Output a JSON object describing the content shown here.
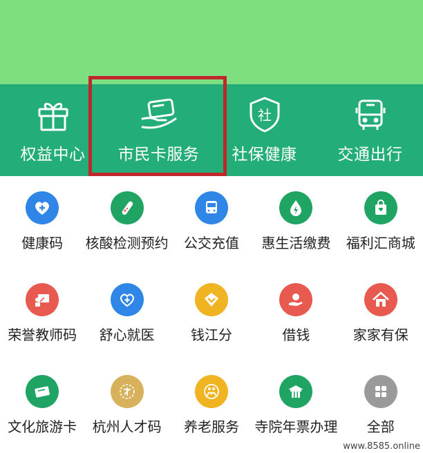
{
  "colors": {
    "banner": "#7ddf7f",
    "main_bar": "#23ad78",
    "highlight": "#c0272d"
  },
  "main_services": [
    {
      "label": "权益中心",
      "icon": "gift-icon"
    },
    {
      "label": "市民卡服务",
      "icon": "card-in-hand-icon"
    },
    {
      "label": "社保健康",
      "icon": "social-security-shield-icon"
    },
    {
      "label": "交通出行",
      "icon": "bus-icon"
    }
  ],
  "shield_text": "社",
  "services": [
    {
      "label": "健康码",
      "icon": "heart-plus-icon",
      "color": "#2f86e6"
    },
    {
      "label": "核酸检测预约",
      "icon": "test-tube-icon",
      "color": "#1fa463"
    },
    {
      "label": "公交充值",
      "icon": "bus-icon",
      "color": "#2f86e6"
    },
    {
      "label": "惠生活缴费",
      "icon": "drop-bolt-icon",
      "color": "#1fa463"
    },
    {
      "label": "福利汇商城",
      "icon": "shopping-bag-icon",
      "color": "#1fa463"
    },
    {
      "label": "荣誉教师码",
      "icon": "teacher-icon",
      "color": "#e85a4f"
    },
    {
      "label": "舒心就医",
      "icon": "medical-heart-icon",
      "color": "#2f86e6"
    },
    {
      "label": "钱江分",
      "icon": "chevron-score-icon",
      "color": "#f0b322"
    },
    {
      "label": "借钱",
      "icon": "hand-coin-icon",
      "color": "#e85a4f"
    },
    {
      "label": "家家有保",
      "icon": "house-icon",
      "color": "#e85a4f"
    },
    {
      "label": "文化旅游卡",
      "icon": "ticket-icon",
      "color": "#1fa463"
    },
    {
      "label": "杭州人才码",
      "icon": "talent-seal-icon",
      "color": "#d8b15c"
    },
    {
      "label": "养老服务",
      "icon": "elderly-care-icon",
      "color": "#f0b322"
    },
    {
      "label": "寺院年票办理",
      "icon": "temple-icon",
      "color": "#1fa463"
    },
    {
      "label": "全部",
      "icon": "grid-all-icon",
      "color": "#9a9a9a"
    }
  ],
  "watermark": "www.8585.online"
}
